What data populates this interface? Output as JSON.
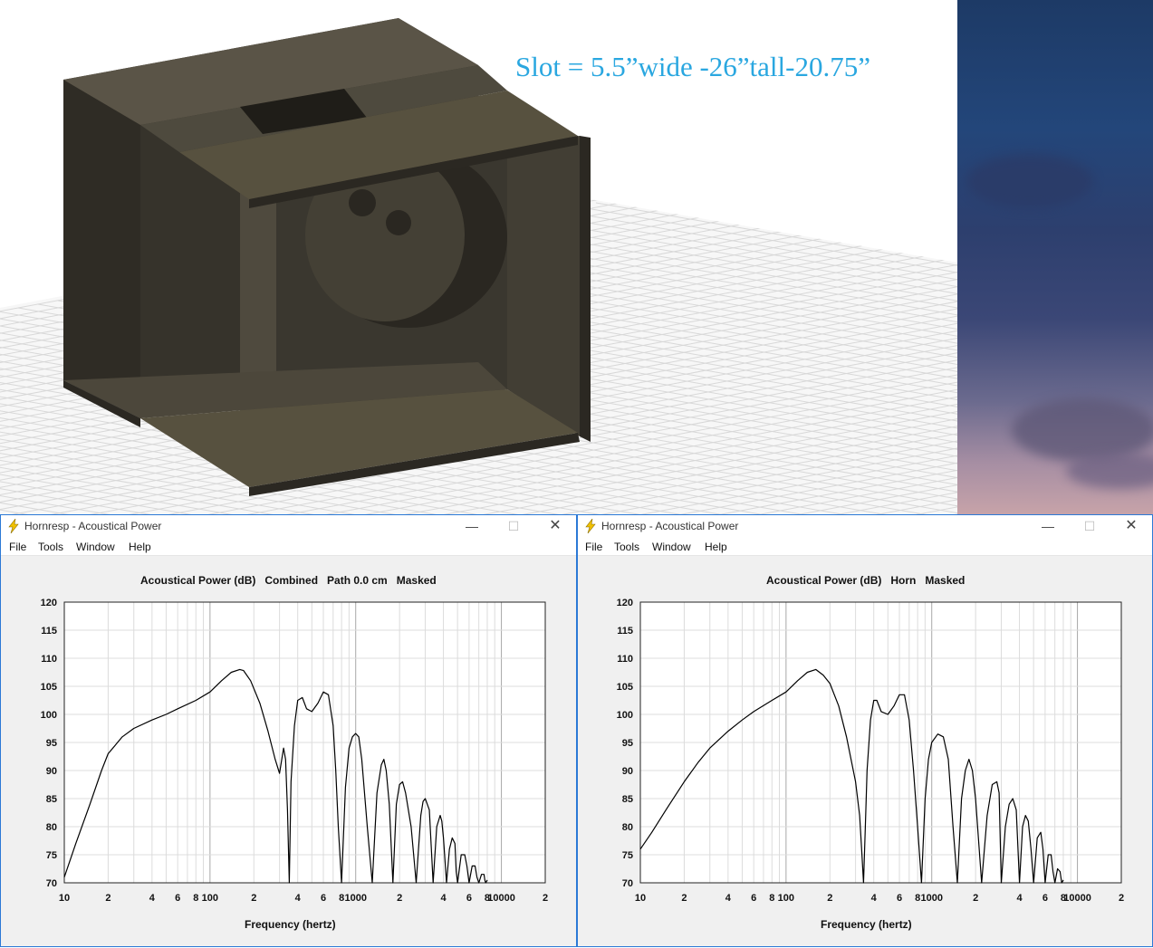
{
  "caption": "Slot = 5.5”wide -26”tall-20.75”",
  "colors": {
    "caption": "#2aa7e0",
    "window_border": "#2b79d6",
    "wood": "#4a4438"
  },
  "windows": [
    {
      "title": "Hornresp - Acoustical Power",
      "menu": [
        "File",
        "Tools",
        "Window",
        "Help"
      ],
      "chart_title": "Acoustical Power (dB)   Combined   Path 0.0 cm   Masked",
      "xlabel": "Frequency (hertz)"
    },
    {
      "title": "Hornresp - Acoustical Power",
      "menu": [
        "File",
        "Tools",
        "Window",
        "Help"
      ],
      "chart_title": "Acoustical Power (dB)   Horn   Masked",
      "xlabel": "Frequency (hertz)"
    }
  ],
  "chart_data": [
    {
      "type": "line",
      "title": "Acoustical Power (dB)   Combined   Path 0.0 cm   Masked",
      "xlabel": "Frequency (hertz)",
      "ylabel": "",
      "x_scale": "log",
      "xlim": [
        10,
        20000
      ],
      "ylim": [
        70,
        120
      ],
      "yticks": [
        120,
        115,
        110,
        105,
        100,
        95,
        90,
        85,
        80,
        75,
        70
      ],
      "xtick_labels": [
        {
          "f": 10,
          "t": "10"
        },
        {
          "f": 20,
          "t": "2"
        },
        {
          "f": 40,
          "t": "4"
        },
        {
          "f": 60,
          "t": "6"
        },
        {
          "f": 80,
          "t": "8"
        },
        {
          "f": 100,
          "t": "100"
        },
        {
          "f": 200,
          "t": "2"
        },
        {
          "f": 400,
          "t": "4"
        },
        {
          "f": 600,
          "t": "6"
        },
        {
          "f": 800,
          "t": "8"
        },
        {
          "f": 1000,
          "t": "1000"
        },
        {
          "f": 2000,
          "t": "2"
        },
        {
          "f": 4000,
          "t": "4"
        },
        {
          "f": 6000,
          "t": "6"
        },
        {
          "f": 8000,
          "t": "8"
        },
        {
          "f": 10000,
          "t": "10000"
        },
        {
          "f": 20000,
          "t": "2"
        }
      ],
      "grid": true,
      "series": [
        {
          "x": [
            10,
            12,
            15,
            18,
            20,
            25,
            30,
            40,
            50,
            60,
            80,
            100,
            120,
            140,
            160,
            170,
            190,
            220,
            250,
            280,
            300,
            320,
            330,
            340,
            350,
            360,
            380,
            400,
            430,
            460,
            500,
            550,
            600,
            650,
            700,
            730,
            760,
            800,
            850,
            900,
            950,
            1000,
            1050,
            1100,
            1200,
            1300,
            1400,
            1500,
            1560,
            1620,
            1700,
            1800,
            1900,
            2000,
            2100,
            2200,
            2400,
            2600,
            2800,
            2900,
            3000,
            3200,
            3400,
            3600,
            3800,
            3900,
            4000,
            4200,
            4400,
            4600,
            4800,
            4900,
            5000,
            5300,
            5600,
            5800,
            6000,
            6300,
            6600,
            6800,
            7000,
            7300,
            7600,
            7700,
            7800,
            8000
          ],
          "y": [
            71,
            77,
            84,
            90,
            93,
            96,
            97.5,
            99,
            100,
            101,
            102.5,
            104,
            106,
            107.5,
            108,
            107.8,
            106,
            102,
            97,
            92,
            89.5,
            94,
            92,
            83,
            70,
            88,
            98,
            102.5,
            103,
            101,
            100.5,
            102,
            104,
            103.5,
            98,
            90,
            80,
            70,
            87,
            94,
            96,
            96.6,
            96,
            92,
            80,
            70,
            86,
            91,
            92,
            90,
            84,
            70,
            84,
            87.5,
            88,
            86,
            80,
            70,
            82,
            84.5,
            85,
            83,
            70,
            80,
            82,
            81,
            78,
            70,
            76,
            78,
            77,
            72,
            70,
            75,
            75,
            73,
            70,
            73,
            73,
            71,
            70,
            71.5,
            71.5,
            70.5,
            70,
            70.5
          ]
        }
      ]
    },
    {
      "type": "line",
      "title": "Acoustical Power (dB)   Horn   Masked",
      "xlabel": "Frequency (hertz)",
      "ylabel": "",
      "x_scale": "log",
      "xlim": [
        10,
        20000
      ],
      "ylim": [
        70,
        120
      ],
      "yticks": [
        120,
        115,
        110,
        105,
        100,
        95,
        90,
        85,
        80,
        75,
        70
      ],
      "xtick_labels": [
        {
          "f": 10,
          "t": "10"
        },
        {
          "f": 20,
          "t": "2"
        },
        {
          "f": 40,
          "t": "4"
        },
        {
          "f": 60,
          "t": "6"
        },
        {
          "f": 80,
          "t": "8"
        },
        {
          "f": 100,
          "t": "100"
        },
        {
          "f": 200,
          "t": "2"
        },
        {
          "f": 400,
          "t": "4"
        },
        {
          "f": 600,
          "t": "6"
        },
        {
          "f": 800,
          "t": "8"
        },
        {
          "f": 1000,
          "t": "1000"
        },
        {
          "f": 2000,
          "t": "2"
        },
        {
          "f": 4000,
          "t": "4"
        },
        {
          "f": 6000,
          "t": "6"
        },
        {
          "f": 8000,
          "t": "8"
        },
        {
          "f": 10000,
          "t": "10000"
        },
        {
          "f": 20000,
          "t": "2"
        }
      ],
      "grid": true,
      "series": [
        {
          "x": [
            10,
            12,
            15,
            20,
            25,
            30,
            40,
            50,
            60,
            80,
            100,
            120,
            140,
            160,
            180,
            200,
            230,
            260,
            300,
            320,
            330,
            340,
            350,
            360,
            380,
            400,
            420,
            450,
            500,
            550,
            600,
            650,
            700,
            750,
            800,
            850,
            900,
            950,
            1000,
            1100,
            1200,
            1300,
            1400,
            1500,
            1600,
            1700,
            1800,
            1900,
            2000,
            2200,
            2400,
            2600,
            2800,
            2900,
            3000,
            3200,
            3400,
            3600,
            3800,
            4000,
            4200,
            4400,
            4600,
            4800,
            5000,
            5300,
            5600,
            5800,
            6000,
            6300,
            6600,
            6800,
            7000,
            7300,
            7600,
            7800,
            8000
          ],
          "y": [
            76,
            79,
            83,
            88,
            91.5,
            94,
            97,
            99,
            100.5,
            102.5,
            104,
            106,
            107.5,
            108,
            107,
            105.5,
            101.5,
            96,
            88,
            82,
            76,
            70,
            80,
            90,
            99,
            102.5,
            102.5,
            100.5,
            100,
            101.5,
            103.5,
            103.5,
            99,
            90,
            80,
            70,
            85,
            92,
            95,
            96.5,
            96,
            92,
            80,
            70,
            85,
            90,
            92,
            90,
            85,
            70,
            82,
            87.5,
            88,
            86,
            70,
            80,
            84,
            85,
            83,
            70,
            80,
            82,
            81,
            76,
            70,
            78,
            79,
            76,
            70,
            75,
            75,
            72,
            70,
            72.5,
            72,
            70,
            70.5
          ]
        }
      ]
    }
  ]
}
